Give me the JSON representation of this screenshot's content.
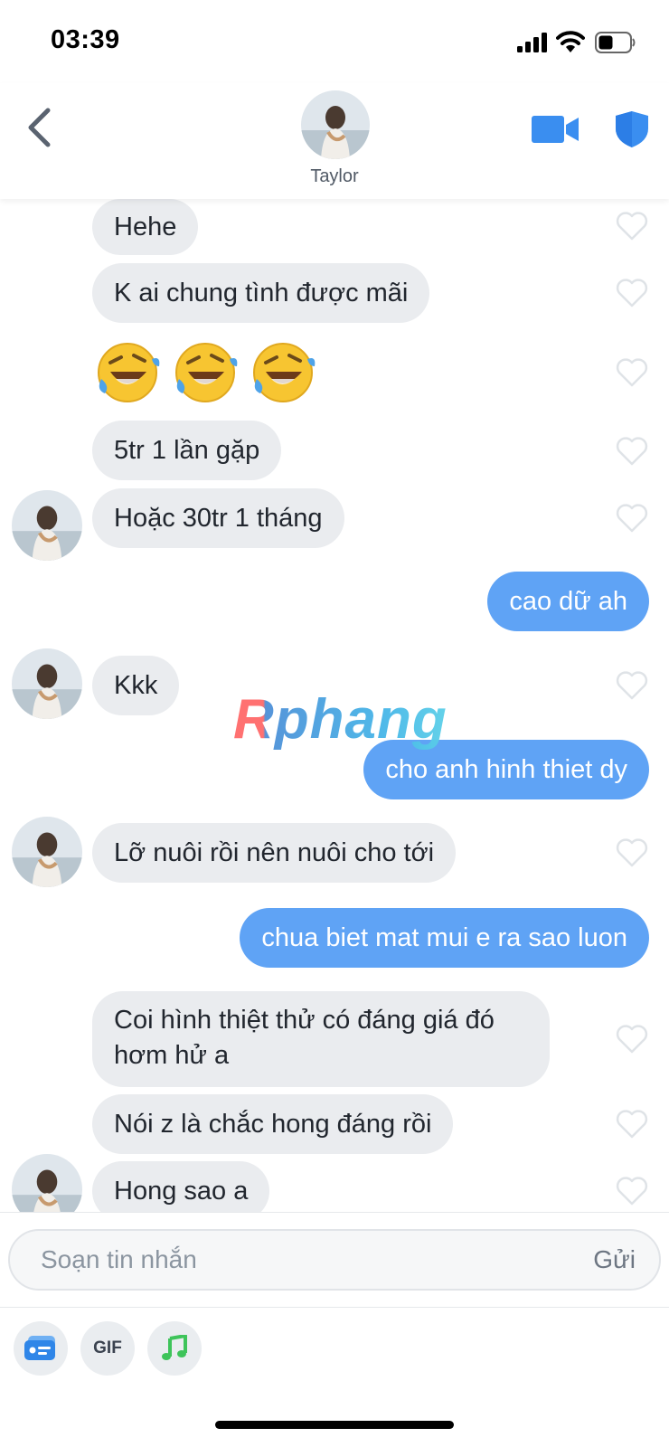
{
  "status_bar": {
    "time": "03:39"
  },
  "header": {
    "contact_name": "Taylor"
  },
  "messages": [
    {
      "dir": "in",
      "text": "Hehe"
    },
    {
      "dir": "in",
      "text": "K ai chung tình được mãi"
    },
    {
      "dir": "in",
      "type": "emoji",
      "text": "🤣🤣🤣"
    },
    {
      "dir": "in",
      "text": "5tr 1 lần gặp"
    },
    {
      "dir": "in",
      "text": "Hoặc 30tr 1 tháng"
    },
    {
      "dir": "out",
      "text": "cao dữ ah"
    },
    {
      "dir": "in",
      "text": "Kkk"
    },
    {
      "dir": "out",
      "text": "cho anh hinh thiet dy"
    },
    {
      "dir": "in",
      "text": "Lỡ nuôi rồi nên nuôi cho tới"
    },
    {
      "dir": "out",
      "text": "chua biet mat mui e ra sao luon"
    },
    {
      "dir": "in",
      "text": "Coi hình thiệt thử có đáng giá đó hơm hử a"
    },
    {
      "dir": "in",
      "text": "Nói z là chắc hong đáng rồi"
    },
    {
      "dir": "in",
      "text": "Hong sao a"
    }
  ],
  "watermark": "Rphang",
  "composer": {
    "placeholder": "Soạn tin nhắn",
    "send_label": "Gửi",
    "gif_label": "GIF"
  },
  "colors": {
    "incoming_bubble": "#eaecef",
    "outgoing_bubble": "#5fa3f5",
    "accent": "#3a8ef0",
    "heart_outline": "#dfe3e7"
  }
}
